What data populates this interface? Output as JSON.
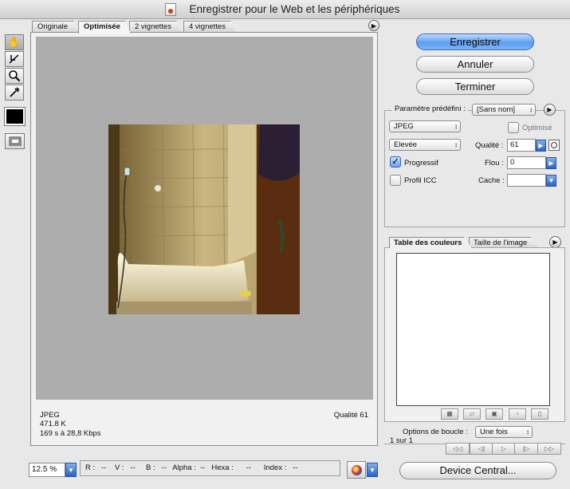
{
  "window": {
    "title": "Enregistrer pour le Web et les périphériques"
  },
  "tabs": [
    {
      "label": "Originale"
    },
    {
      "label": "Optimisée"
    },
    {
      "label": "2 vignettes"
    },
    {
      "label": "4 vignettes"
    }
  ],
  "active_tab": "Optimisée",
  "tools": [
    "hand-icon",
    "slice-select-icon",
    "zoom-icon",
    "eyedropper-icon"
  ],
  "preview_info": {
    "format": "JPEG",
    "size": "471.8 K",
    "download_time": "169 s à 28,8 Kbps",
    "quality": "Qualité 61"
  },
  "buttons": {
    "save": "Enregistrer",
    "cancel": "Annuler",
    "done": "Terminer",
    "device_central": "Device Central..."
  },
  "settings": {
    "preset_label": "Paramètre prédéfini :",
    "preset_value": "[Sans nom]",
    "format": "JPEG",
    "quality_level": "Elevée",
    "optimized_label": "Optimisé",
    "optimized_checked": false,
    "progressive_label": "Progressif",
    "progressive_checked": true,
    "icc_label": "Profil ICC",
    "icc_checked": false,
    "quality_label": "Qualité :",
    "quality_value": "61",
    "blur_label": "Flou :",
    "blur_value": "0",
    "matte_label": "Cache :",
    "matte_value": ""
  },
  "color_table": {
    "tabs": [
      {
        "label": "Table des couleurs"
      },
      {
        "label": "Taille de l'image"
      }
    ]
  },
  "loop": {
    "label": "Options de boucle :",
    "value": "Une fois",
    "frame_counter": "1 sur 1"
  },
  "status_bar": {
    "zoom": "12.5 %",
    "readout": "R :   --    V :   --     B :   --   Alpha :  --   Hexa :      --      Index :   --"
  },
  "colors": {
    "canvas_bg": "#adadad",
    "primary_button": "#5c9ef0",
    "foreground_swatch": "#000000"
  }
}
